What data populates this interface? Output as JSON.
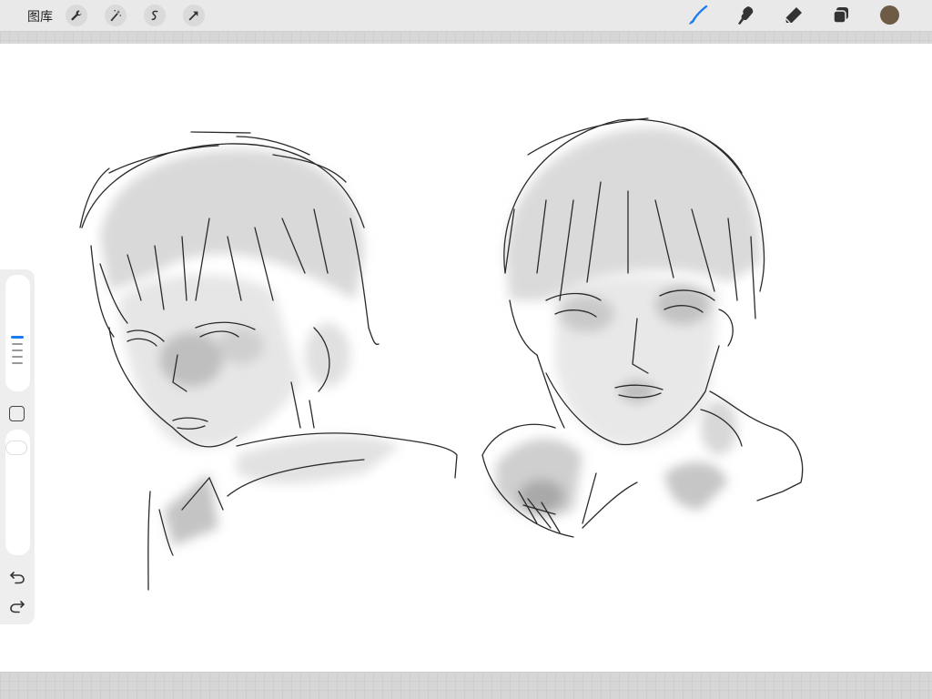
{
  "toolbar": {
    "gallery_label": "图库",
    "left_tools": [
      {
        "name": "actions",
        "icon": "wrench-icon"
      },
      {
        "name": "adjustments",
        "icon": "magic-wand-icon"
      },
      {
        "name": "selection",
        "icon": "selection-s-icon"
      },
      {
        "name": "transform",
        "icon": "arrow-cursor-icon"
      }
    ],
    "right_tools": [
      {
        "name": "brush",
        "icon": "brush-icon",
        "active": true
      },
      {
        "name": "smudge",
        "icon": "smudge-icon",
        "active": false
      },
      {
        "name": "eraser",
        "icon": "eraser-icon",
        "active": false
      },
      {
        "name": "layers",
        "icon": "layers-icon",
        "active": false
      }
    ],
    "current_color": "#6d5b45",
    "active_color": "#1a7cf0"
  },
  "sidebar": {
    "controls": [
      "brush-size-slider",
      "modify-button",
      "opacity-slider",
      "undo-button",
      "redo-button"
    ]
  },
  "canvas": {
    "content": "pencil-sketch-two-portraits",
    "background": "#ffffff"
  }
}
